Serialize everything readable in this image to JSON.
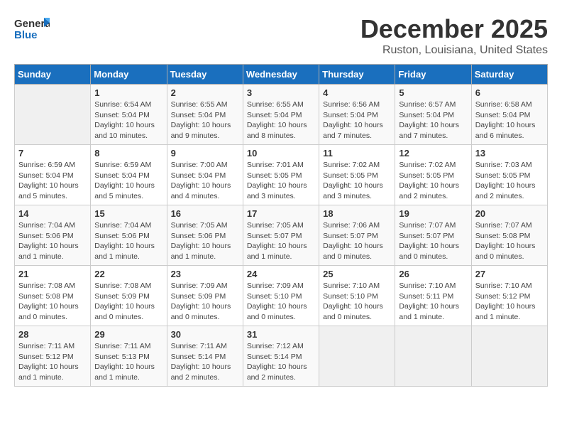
{
  "header": {
    "logo_general": "General",
    "logo_blue": "Blue",
    "month_title": "December 2025",
    "location": "Ruston, Louisiana, United States"
  },
  "days_of_week": [
    "Sunday",
    "Monday",
    "Tuesday",
    "Wednesday",
    "Thursday",
    "Friday",
    "Saturday"
  ],
  "weeks": [
    [
      {
        "day": "",
        "info": ""
      },
      {
        "day": "1",
        "info": "Sunrise: 6:54 AM\nSunset: 5:04 PM\nDaylight: 10 hours\nand 10 minutes."
      },
      {
        "day": "2",
        "info": "Sunrise: 6:55 AM\nSunset: 5:04 PM\nDaylight: 10 hours\nand 9 minutes."
      },
      {
        "day": "3",
        "info": "Sunrise: 6:55 AM\nSunset: 5:04 PM\nDaylight: 10 hours\nand 8 minutes."
      },
      {
        "day": "4",
        "info": "Sunrise: 6:56 AM\nSunset: 5:04 PM\nDaylight: 10 hours\nand 7 minutes."
      },
      {
        "day": "5",
        "info": "Sunrise: 6:57 AM\nSunset: 5:04 PM\nDaylight: 10 hours\nand 7 minutes."
      },
      {
        "day": "6",
        "info": "Sunrise: 6:58 AM\nSunset: 5:04 PM\nDaylight: 10 hours\nand 6 minutes."
      }
    ],
    [
      {
        "day": "7",
        "info": "Sunrise: 6:59 AM\nSunset: 5:04 PM\nDaylight: 10 hours\nand 5 minutes."
      },
      {
        "day": "8",
        "info": "Sunrise: 6:59 AM\nSunset: 5:04 PM\nDaylight: 10 hours\nand 5 minutes."
      },
      {
        "day": "9",
        "info": "Sunrise: 7:00 AM\nSunset: 5:04 PM\nDaylight: 10 hours\nand 4 minutes."
      },
      {
        "day": "10",
        "info": "Sunrise: 7:01 AM\nSunset: 5:05 PM\nDaylight: 10 hours\nand 3 minutes."
      },
      {
        "day": "11",
        "info": "Sunrise: 7:02 AM\nSunset: 5:05 PM\nDaylight: 10 hours\nand 3 minutes."
      },
      {
        "day": "12",
        "info": "Sunrise: 7:02 AM\nSunset: 5:05 PM\nDaylight: 10 hours\nand 2 minutes."
      },
      {
        "day": "13",
        "info": "Sunrise: 7:03 AM\nSunset: 5:05 PM\nDaylight: 10 hours\nand 2 minutes."
      }
    ],
    [
      {
        "day": "14",
        "info": "Sunrise: 7:04 AM\nSunset: 5:06 PM\nDaylight: 10 hours\nand 1 minute."
      },
      {
        "day": "15",
        "info": "Sunrise: 7:04 AM\nSunset: 5:06 PM\nDaylight: 10 hours\nand 1 minute."
      },
      {
        "day": "16",
        "info": "Sunrise: 7:05 AM\nSunset: 5:06 PM\nDaylight: 10 hours\nand 1 minute."
      },
      {
        "day": "17",
        "info": "Sunrise: 7:05 AM\nSunset: 5:07 PM\nDaylight: 10 hours\nand 1 minute."
      },
      {
        "day": "18",
        "info": "Sunrise: 7:06 AM\nSunset: 5:07 PM\nDaylight: 10 hours\nand 0 minutes."
      },
      {
        "day": "19",
        "info": "Sunrise: 7:07 AM\nSunset: 5:07 PM\nDaylight: 10 hours\nand 0 minutes."
      },
      {
        "day": "20",
        "info": "Sunrise: 7:07 AM\nSunset: 5:08 PM\nDaylight: 10 hours\nand 0 minutes."
      }
    ],
    [
      {
        "day": "21",
        "info": "Sunrise: 7:08 AM\nSunset: 5:08 PM\nDaylight: 10 hours\nand 0 minutes."
      },
      {
        "day": "22",
        "info": "Sunrise: 7:08 AM\nSunset: 5:09 PM\nDaylight: 10 hours\nand 0 minutes."
      },
      {
        "day": "23",
        "info": "Sunrise: 7:09 AM\nSunset: 5:09 PM\nDaylight: 10 hours\nand 0 minutes."
      },
      {
        "day": "24",
        "info": "Sunrise: 7:09 AM\nSunset: 5:10 PM\nDaylight: 10 hours\nand 0 minutes."
      },
      {
        "day": "25",
        "info": "Sunrise: 7:10 AM\nSunset: 5:10 PM\nDaylight: 10 hours\nand 0 minutes."
      },
      {
        "day": "26",
        "info": "Sunrise: 7:10 AM\nSunset: 5:11 PM\nDaylight: 10 hours\nand 1 minute."
      },
      {
        "day": "27",
        "info": "Sunrise: 7:10 AM\nSunset: 5:12 PM\nDaylight: 10 hours\nand 1 minute."
      }
    ],
    [
      {
        "day": "28",
        "info": "Sunrise: 7:11 AM\nSunset: 5:12 PM\nDaylight: 10 hours\nand 1 minute."
      },
      {
        "day": "29",
        "info": "Sunrise: 7:11 AM\nSunset: 5:13 PM\nDaylight: 10 hours\nand 1 minute."
      },
      {
        "day": "30",
        "info": "Sunrise: 7:11 AM\nSunset: 5:14 PM\nDaylight: 10 hours\nand 2 minutes."
      },
      {
        "day": "31",
        "info": "Sunrise: 7:12 AM\nSunset: 5:14 PM\nDaylight: 10 hours\nand 2 minutes."
      },
      {
        "day": "",
        "info": ""
      },
      {
        "day": "",
        "info": ""
      },
      {
        "day": "",
        "info": ""
      }
    ]
  ]
}
